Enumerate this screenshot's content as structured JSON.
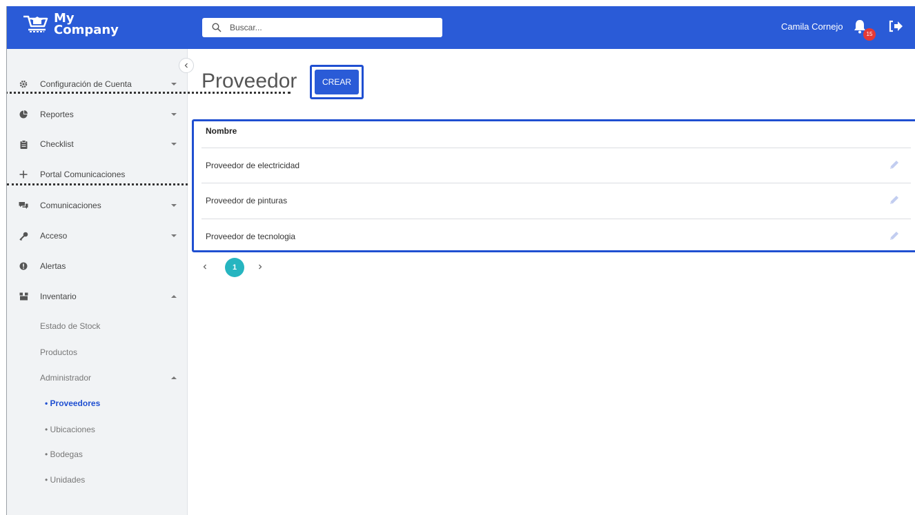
{
  "header": {
    "logo_line1": "My",
    "logo_line2": "Company",
    "search_placeholder": "Buscar...",
    "user_name": "Camila Cornejo",
    "notification_count": "15",
    "brand_color": "#2a5bd7"
  },
  "sidebar": {
    "items": [
      {
        "label": "Configuración de Cuenta",
        "icon": "gear-icon"
      },
      {
        "label": "Reportes",
        "icon": "pie-chart-icon"
      },
      {
        "label": "Checklist",
        "icon": "clipboard-icon"
      },
      {
        "label": "Portal Comunicaciones",
        "icon": "plus-icon"
      },
      {
        "label": "Comunicaciones",
        "icon": "chat-icon"
      },
      {
        "label": "Acceso",
        "icon": "key-icon"
      },
      {
        "label": "Alertas",
        "icon": "alert-icon"
      },
      {
        "label": "Inventario",
        "icon": "box-icon"
      }
    ],
    "inventario_sub": {
      "estado_stock": "Estado de Stock",
      "productos": "Productos",
      "administrador": "Administrador"
    },
    "administrador_sub": [
      {
        "label": "• Proveedores",
        "active": true
      },
      {
        "label": "• Ubicaciones",
        "active": false
      },
      {
        "label": "• Bodegas",
        "active": false
      },
      {
        "label": "• Unidades",
        "active": false
      }
    ]
  },
  "main": {
    "title": "Proveedor",
    "create_label": "CREAR",
    "table": {
      "header": "Nombre",
      "rows": [
        "Proveedor de electricidad",
        "Proveedor de pinturas",
        "Proveedor de tecnologia"
      ]
    },
    "pagination": {
      "current": "1"
    }
  }
}
